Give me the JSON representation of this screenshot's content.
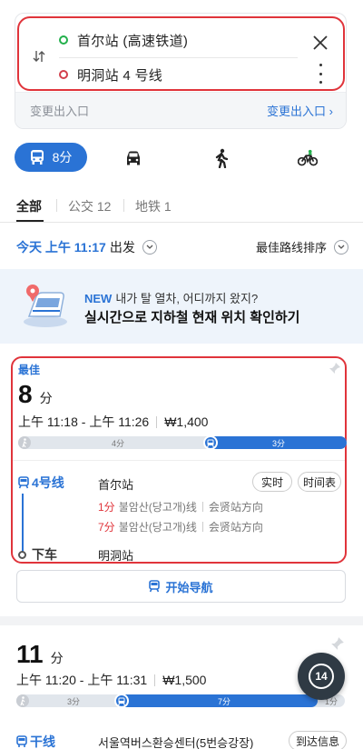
{
  "search": {
    "origin": "首尔站 (高速铁道)",
    "destination": "明洞站 4 号线",
    "entrance_left": "变更出入口",
    "entrance_right": "变更出入口 ›"
  },
  "modes": {
    "transit_label": "8分",
    "icons": [
      "bus-icon",
      "car-icon",
      "walk-icon",
      "bike-icon"
    ],
    "active": "transit"
  },
  "filter_tabs": [
    {
      "label": "全部",
      "active": true
    },
    {
      "label": "公交 12",
      "active": false
    },
    {
      "label": "地铁 1",
      "active": false
    }
  ],
  "departure": {
    "time": "今天 上午 11:17",
    "suffix": "出发",
    "sort_label": "最佳路线排序"
  },
  "banner": {
    "new_tag": "NEW",
    "line1": "내가 탈 열차, 어디까지 왔지?",
    "line2": "실시간으로 지하철 현재 위치 확인하기"
  },
  "route1": {
    "badge": "最佳",
    "duration_num": "8",
    "duration_unit": "分",
    "time_range": "上午 11:18 - 上午 11:26",
    "fare": "₩1,400",
    "walk_minutes": "4分",
    "subway_minutes": "3分",
    "walk_fraction": 0.57,
    "line_name": "4号线",
    "board_station": "首尔站",
    "btn_realtime": "实时",
    "btn_timetable": "时间表",
    "arrivals": [
      {
        "min": "1分",
        "dest": "불암산(당고개)线",
        "dir": "会贤站方向"
      },
      {
        "min": "7分",
        "dest": "불암산(당고개)线",
        "dir": "会贤站方向"
      }
    ],
    "alight_label": "下车",
    "alight_station": "明洞站",
    "nav_label": "开始导航"
  },
  "route2": {
    "duration_num": "11",
    "duration_unit": "分",
    "time_range": "上午 11:20 - 上午 11:31",
    "fare": "₩1,500",
    "walk1_minutes": "3分",
    "bus_minutes": "7分",
    "walk2_minutes": "1分",
    "line_name": "干线",
    "board_station": "서울역버스환승센터(5번승강장)",
    "btn_arrival": "到达信息"
  },
  "fab": {
    "label": "14"
  },
  "colors": {
    "accent": "#2a73d5",
    "highlight": "#e0343b",
    "origin_dot": "#22b04b",
    "dest_dot": "#d23f4b"
  }
}
